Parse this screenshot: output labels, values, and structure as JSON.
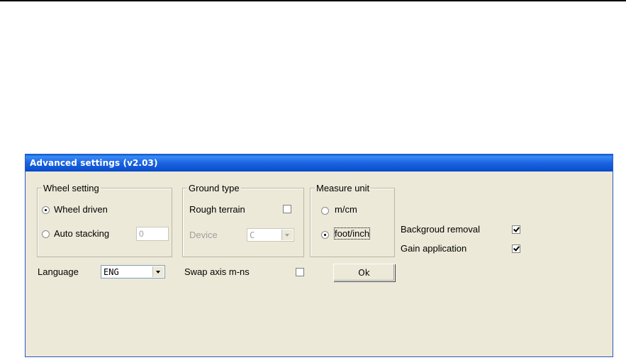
{
  "window": {
    "title": "Advanced settings (v2.03)"
  },
  "wheel_setting": {
    "legend": "Wheel setting",
    "options": [
      {
        "label": "Wheel driven",
        "selected": true
      },
      {
        "label": "Auto stacking",
        "selected": false
      }
    ],
    "stack_value": "0"
  },
  "ground_type": {
    "legend": "Ground type",
    "rough_terrain_label": "Rough terrain",
    "rough_terrain_checked": false,
    "device_label": "Device",
    "device_value": "C"
  },
  "measure_unit": {
    "legend": "Measure unit",
    "options": [
      {
        "label": "m/cm",
        "selected": false
      },
      {
        "label": "foot/inch",
        "selected": true
      }
    ]
  },
  "options": {
    "background_removal_label": "Backgroud removal",
    "background_removal_checked": true,
    "gain_application_label": "Gain application",
    "gain_application_checked": true
  },
  "bottom": {
    "language_label": "Language",
    "language_value": "ENG",
    "swap_axis_label": "Swap axis m-ns",
    "swap_axis_checked": false,
    "ok_label": "Ok"
  },
  "colors": {
    "titlebar": "#0a5ddb",
    "dialog_bg": "#ece9d8",
    "disabled_text": "#a0a0a0"
  }
}
